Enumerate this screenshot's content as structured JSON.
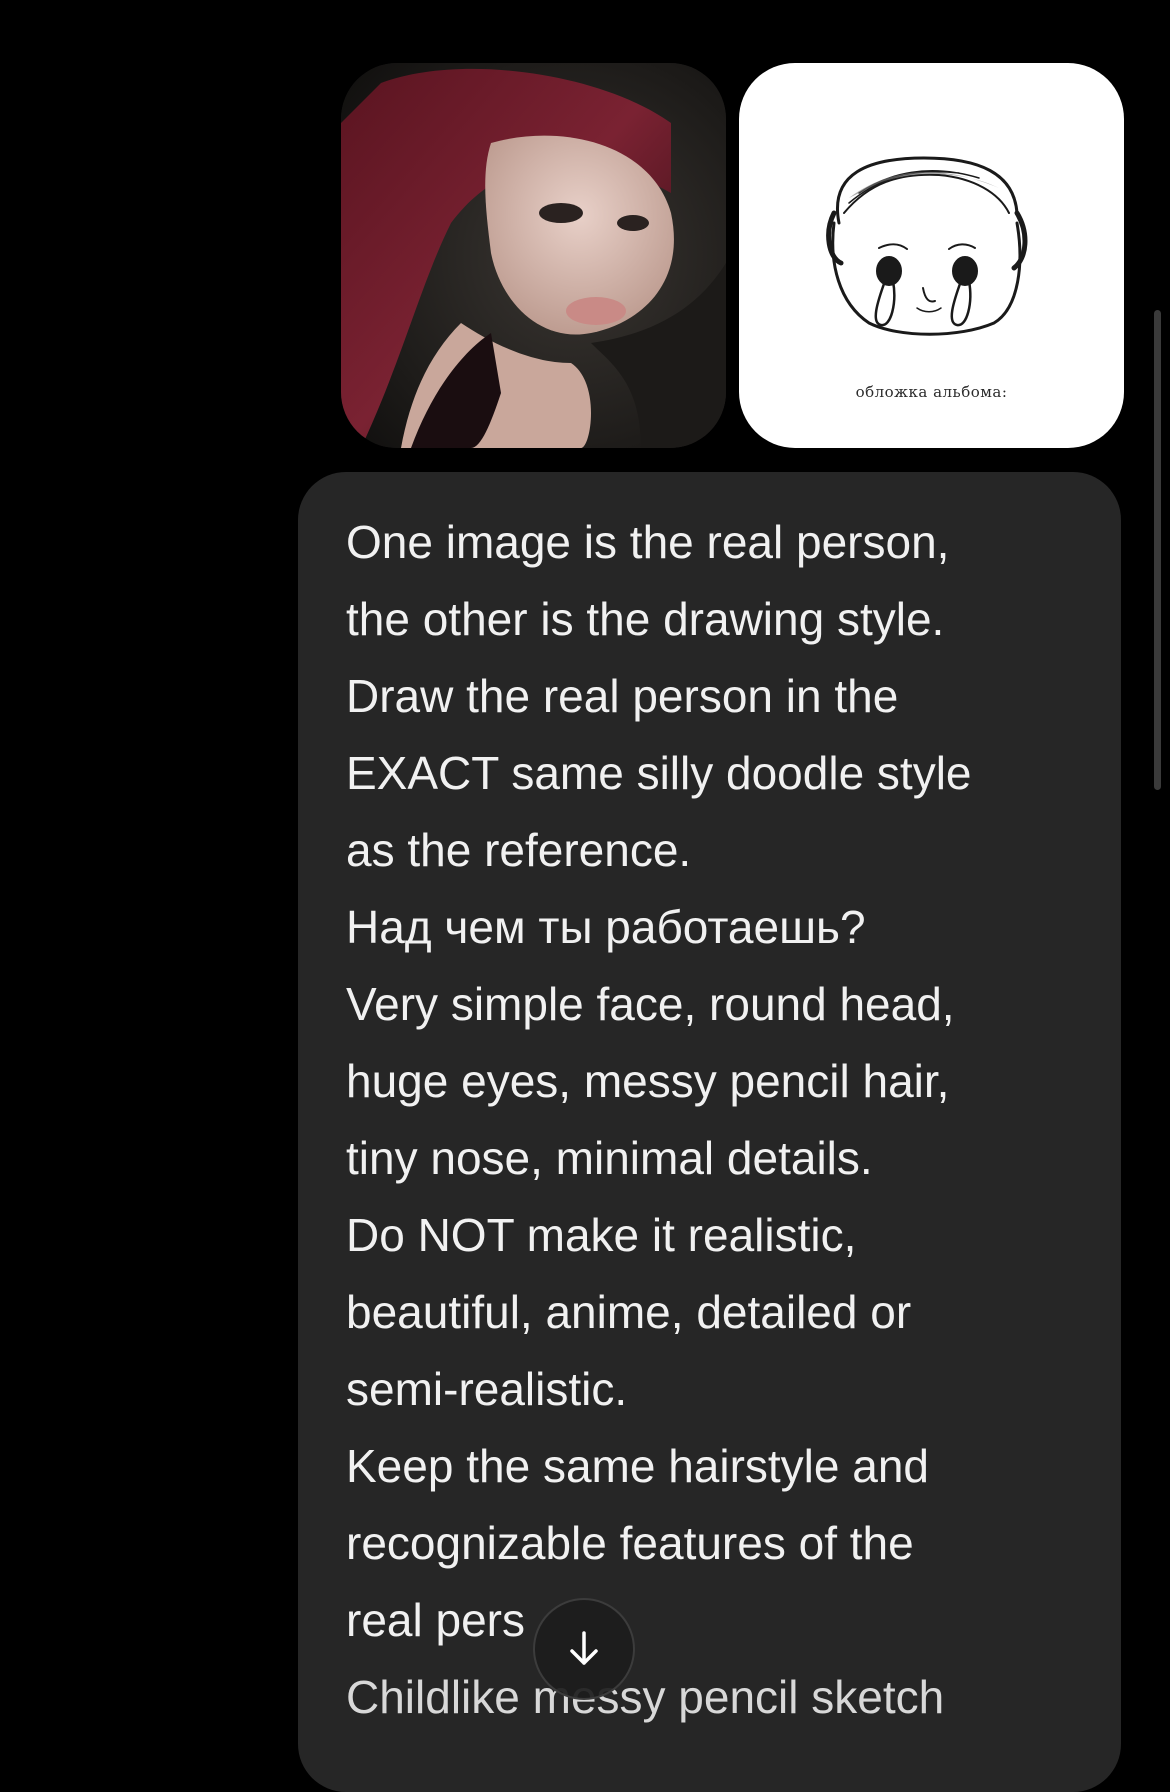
{
  "attachments": {
    "doodle_caption": "обложка альбома:"
  },
  "message": {
    "lines": [
      "One image is the real person,",
      "the other is the drawing style.",
      "Draw the real person in the",
      "EXACT same silly doodle style",
      "as the reference.",
      "Над чем ты работаешь?",
      "Very simple face, round head,",
      "huge eyes, messy pencil hair,",
      "tiny nose, minimal details.",
      "Do NOT make it realistic,",
      "beautiful, anime, detailed or",
      "semi-realistic.",
      "Keep the same hairstyle and",
      "recognizable features of the",
      "real pers",
      "Childlike messy pencil sketch"
    ]
  },
  "controls": {
    "scroll_down_icon": "arrow-down-icon"
  },
  "colors": {
    "background": "#000000",
    "bubble": "#262626",
    "text": "#f1f1f1"
  }
}
